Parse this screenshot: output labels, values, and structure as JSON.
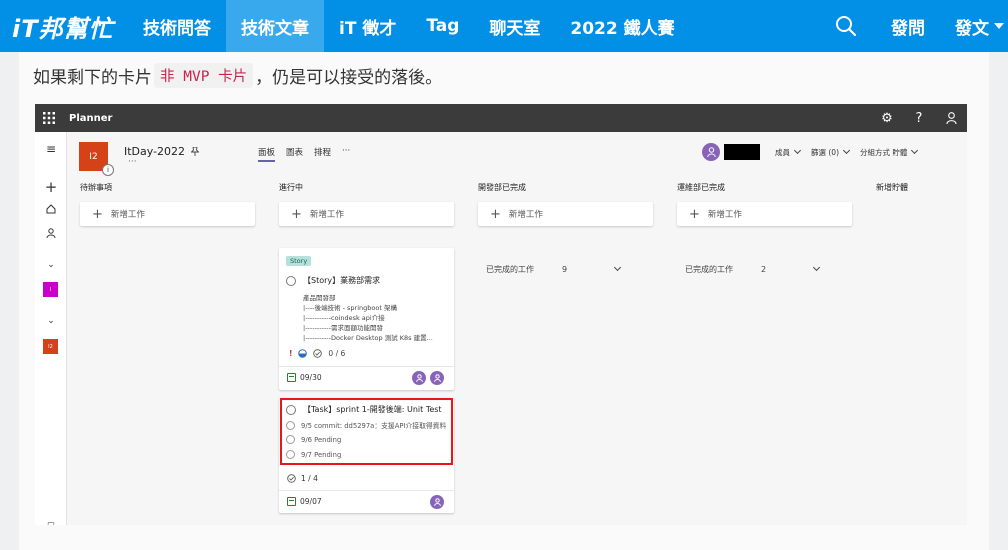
{
  "nav": {
    "logo": "iT邦幫忙",
    "items": [
      "技術問答",
      "技術文章",
      "iT 徵才",
      "Tag",
      "聊天室",
      "2022 鐵人賽"
    ],
    "active_index": 1,
    "ask": "發問",
    "post": "發文"
  },
  "article": {
    "text_before": "如果剩下的卡片",
    "code": "非 MVP 卡片",
    "text_after": "，仍是可以接受的落後。"
  },
  "planner": {
    "app_title": "Planner",
    "plan_name": "ItDay-2022",
    "plan_icon": "I2",
    "plan_more": "···",
    "tabs": [
      "面板",
      "圖表",
      "排程",
      "···"
    ],
    "filters": {
      "members": "成員",
      "filter": "篩選 (0)",
      "group": "分組方式 貯體"
    },
    "columns": [
      {
        "name": "待辦事項",
        "add_label": "新增工作"
      },
      {
        "name": "進行中",
        "add_label": "新增工作"
      },
      {
        "name": "開發部已完成",
        "add_label": "新增工作",
        "completed_label": "已完成的工作",
        "completed_count": "9"
      },
      {
        "name": "運維部已完成",
        "add_label": "新增工作",
        "completed_label": "已完成的工作",
        "completed_count": "2"
      },
      {
        "name": "新增貯體"
      }
    ],
    "card_story": {
      "tag": "Story",
      "title": "【Story】業務部需求",
      "desc": [
        "產品開發部",
        "|----後端技術 - springboot 架構",
        "|-----------coindesk api介接",
        "|-----------需求面額功能開發",
        "|-----------Docker Desktop 測試 K8s 建置..."
      ],
      "checklist": "0 / 6",
      "due": "09/30"
    },
    "card_task": {
      "title": "【Task】sprint 1-開發後端: Unit Test",
      "items": [
        "9/5 commit: dd5297a：支援API介接取得資料",
        "9/6 Pending",
        "9/7 Pending"
      ],
      "checklist": "1 / 4",
      "due": "09/07"
    },
    "left_plan_badge": "I2"
  },
  "colors": {
    "nav_bg": "#0290e6",
    "nav_active": "#39a9ee",
    "plan_orange": "#d54218",
    "avatar_purple": "#8764b8",
    "highlight_red": "#e8161b",
    "story_tag": "#b5e1dd",
    "left_plan_magenta": "#c800c8"
  }
}
